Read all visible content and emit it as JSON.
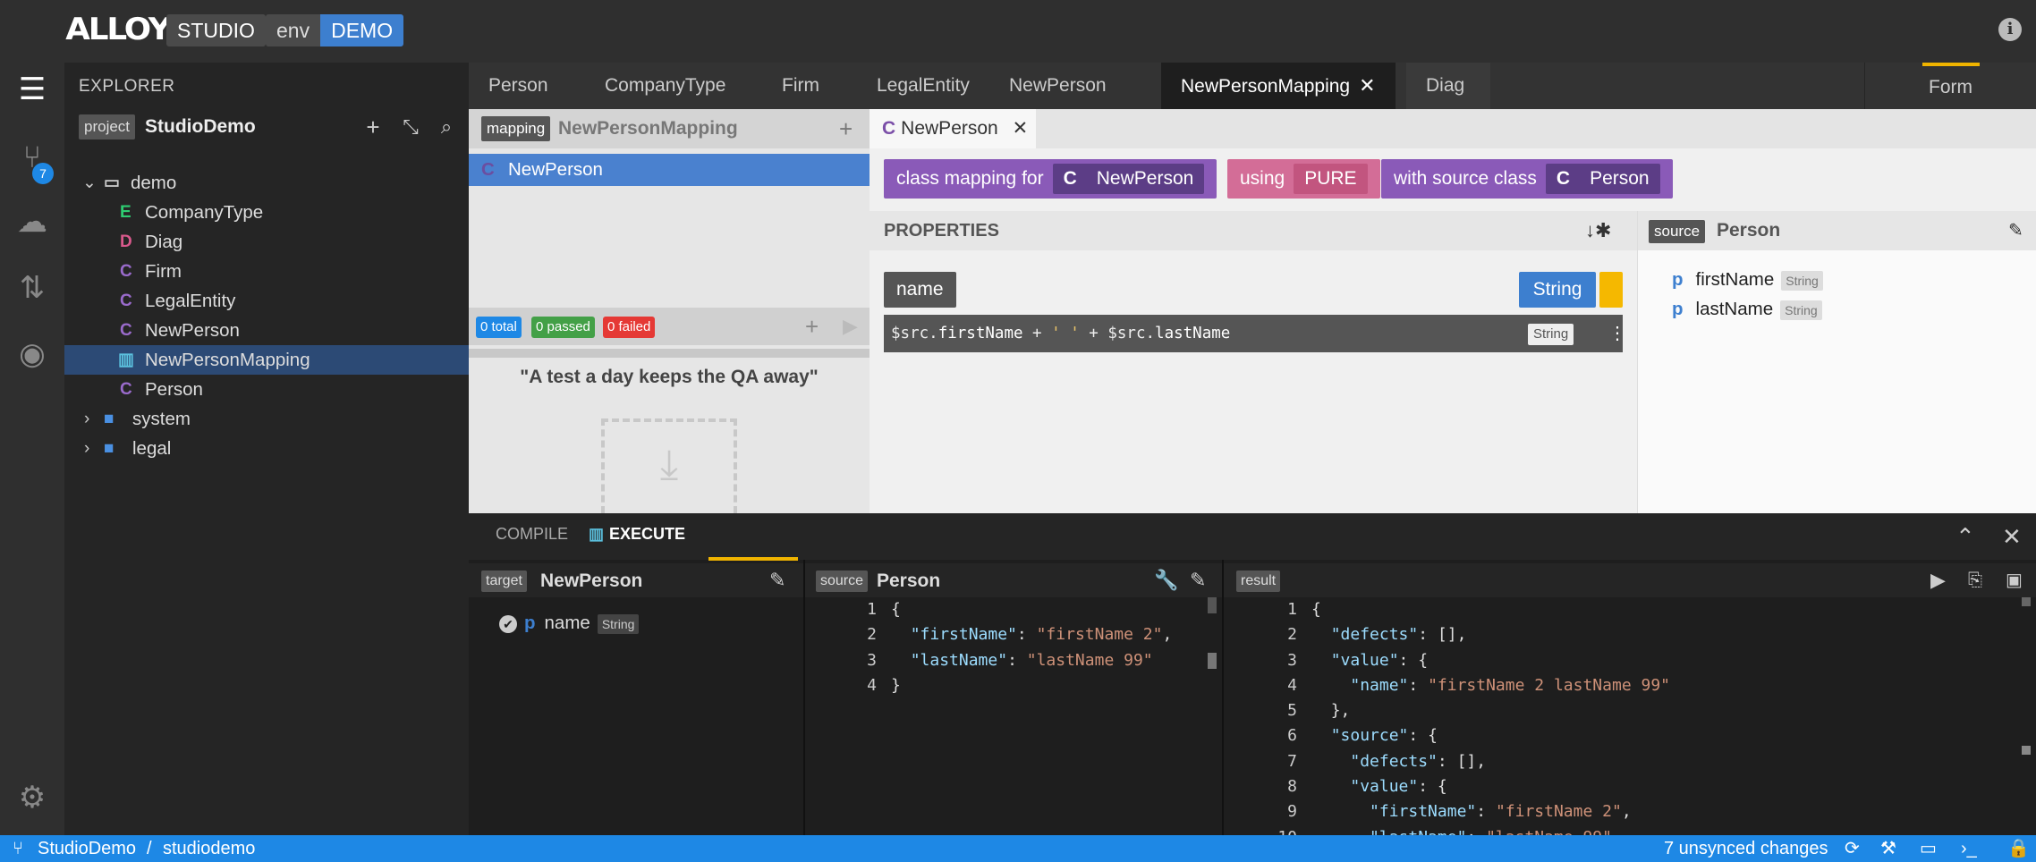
{
  "header": {
    "logo": "ALLOY",
    "studio": "STUDIO",
    "env_label": "env",
    "env_value": "DEMO"
  },
  "activity": {
    "changes_badge": "7"
  },
  "explorer": {
    "title": "EXPLORER",
    "project_tag": "project",
    "project_name": "StudioDemo",
    "tree": [
      {
        "type": "folder-open",
        "label": "demo"
      },
      {
        "type": "E",
        "label": "CompanyType"
      },
      {
        "type": "D",
        "label": "Diag"
      },
      {
        "type": "C",
        "label": "Firm"
      },
      {
        "type": "C",
        "label": "LegalEntity"
      },
      {
        "type": "C",
        "label": "NewPerson"
      },
      {
        "type": "M",
        "label": "NewPersonMapping"
      },
      {
        "type": "C",
        "label": "Person"
      },
      {
        "type": "folder",
        "label": "system"
      },
      {
        "type": "folder",
        "label": "legal"
      }
    ]
  },
  "tabs": [
    "Person",
    "CompanyType",
    "Firm",
    "LegalEntity",
    "NewPerson",
    "NewPersonMapping",
    "Diag"
  ],
  "form_tab": "Form",
  "mapping_explorer": {
    "tag": "mapping",
    "name": "NewPersonMapping",
    "item": "NewPerson",
    "tests": {
      "total": "0 total",
      "passed": "0 passed",
      "failed": "0 failed"
    },
    "quote": "\"A test a day keeps the QA away\""
  },
  "editor": {
    "tab": "NewPerson",
    "class_mapping_label": "class mapping for",
    "class_name": "NewPerson",
    "using_label": "using",
    "using_value": "PURE",
    "source_class_label": "with source class",
    "source_class": "Person",
    "properties_title": "PROPERTIES",
    "property": {
      "name": "name",
      "type": "String"
    },
    "expression": {
      "p1": "$src.",
      "f1": "firstName",
      "p2": " + ",
      "s1": "' '",
      "p3": " + $src.",
      "f2": "lastName"
    },
    "expression_type": "String",
    "source_panel": {
      "tag": "source",
      "name": "Person",
      "props": [
        {
          "name": "firstName",
          "type": "String"
        },
        {
          "name": "lastName",
          "type": "String"
        }
      ]
    }
  },
  "bottom": {
    "tabs": [
      "COMPILE",
      "EXECUTE"
    ],
    "target_tag": "target",
    "target_name": "NewPerson",
    "target_prop": {
      "name": "name",
      "type": "String"
    },
    "source_tag": "source",
    "source_name": "Person",
    "result_tag": "result"
  },
  "status": {
    "project": "StudioDemo",
    "sep": "/",
    "workspace": "studiodemo",
    "changes": "7 unsynced changes"
  }
}
